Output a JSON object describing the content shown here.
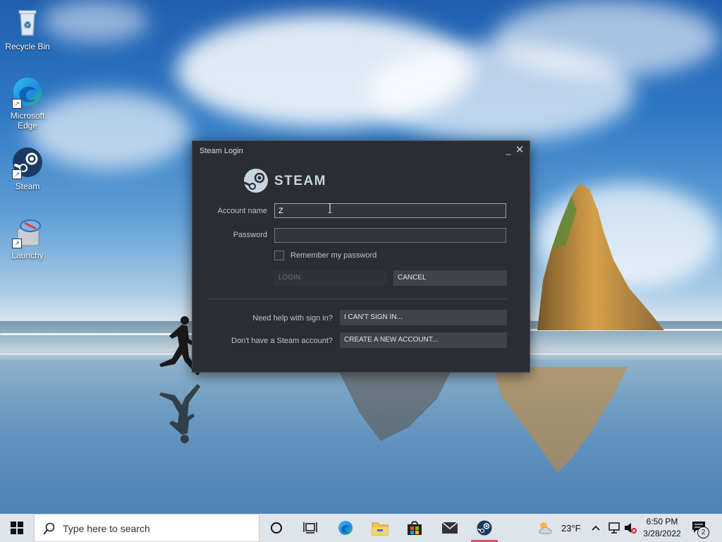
{
  "desktop": {
    "icons": [
      {
        "label": "Recycle Bin",
        "icon": "recycle-bin-icon"
      },
      {
        "label": "Microsoft Edge",
        "icon": "edge-icon"
      },
      {
        "label": "Steam",
        "icon": "steam-icon"
      },
      {
        "label": "Launchy",
        "icon": "launchy-icon"
      }
    ]
  },
  "dialog": {
    "title": "Steam Login",
    "logo_text": "STEAM",
    "account_label": "Account name",
    "account_value": "Z",
    "password_label": "Password",
    "password_value": "",
    "remember_label": "Remember my password",
    "remember_checked": false,
    "login_label": "LOGIN",
    "cancel_label": "CANCEL",
    "help_label": "Need help with sign in?",
    "cant_sign_in_label": "I CAN'T SIGN IN...",
    "no_account_label": "Don't have a Steam account?",
    "create_account_label": "CREATE A NEW ACCOUNT..."
  },
  "taskbar": {
    "search_placeholder": "Type here to search",
    "pinned": [
      "task-view-icon",
      "cortana-icon",
      "edge-icon",
      "file-explorer-icon",
      "store-icon",
      "mail-icon",
      "steam-icon"
    ],
    "active_app": "Steam",
    "weather": "23°F",
    "time": "6:50 PM",
    "date": "3/28/2022",
    "notification_count": "2"
  },
  "colors": {
    "dialog_bg": "#2a2d33",
    "button_bg": "#3f434a",
    "taskbar_bg": "#dfe3ea",
    "active_indicator": "#e05070"
  }
}
